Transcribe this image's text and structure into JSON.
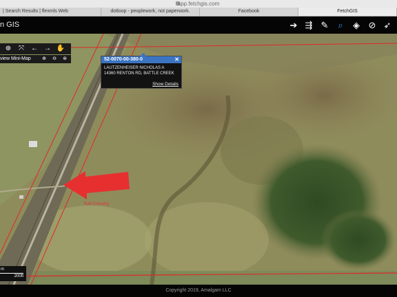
{
  "browser": {
    "address_text": "app.fetchgis.com",
    "tabs": [
      {
        "label": "| Search Results | flexmls Web",
        "active": false
      },
      {
        "label": "dotloop - peoplework, not paperwork.",
        "active": false
      },
      {
        "label": "Facebook",
        "active": false
      },
      {
        "label": "FetchGIS",
        "active": true
      }
    ]
  },
  "app": {
    "title": "n GIS",
    "tools": [
      {
        "name": "login-icon",
        "glyph": "➔",
        "active": false
      },
      {
        "name": "signpost-icon",
        "glyph": "⇶",
        "active": false
      },
      {
        "name": "wrench-icon",
        "glyph": "✎",
        "active": false
      },
      {
        "name": "search-icon",
        "glyph": "⌕",
        "active": true
      },
      {
        "name": "layers-icon",
        "glyph": "◈",
        "active": false
      },
      {
        "name": "no-select-icon",
        "glyph": "⊘",
        "active": false
      },
      {
        "name": "measure-icon",
        "glyph": "➶",
        "active": false
      }
    ]
  },
  "map_controls": {
    "nav_buttons": [
      "zoom-in-icon",
      "full-extent-icon",
      "back-arrow-icon",
      "forward-arrow-icon",
      "pan-hand-icon"
    ],
    "minimap_label": "view Mini-Map"
  },
  "popup": {
    "parcel_id": "52-0070-00-380-0",
    "owner": "LAUTZENHEISER NICHOLAS A",
    "address": "14360 RENTON RD, BATTLE CREEK",
    "link_label": "Show Details",
    "close_glyph": "✕"
  },
  "annotation": {
    "label": "Rail Crossing",
    "color": "#e63030"
  },
  "scale": {
    "metric_label": "m",
    "imperial_label": "200ft"
  },
  "footer": {
    "copyright": "Copyright 2019, Amalgam LLC"
  },
  "colors": {
    "accent_blue": "#3b74c2",
    "parcel_line": "#e02828"
  }
}
